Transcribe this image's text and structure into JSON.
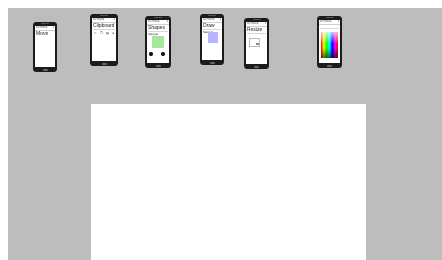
{
  "phones": [
    {
      "id": "move",
      "topbar": "ACTIVATE",
      "title": "Move"
    },
    {
      "id": "clipboard",
      "topbar": "ACTIVATE",
      "title": "Clipboard",
      "icons": [
        "cut-icon",
        "copy-icon",
        "paste-icon",
        "delete-icon"
      ]
    },
    {
      "id": "shapes",
      "topbar": "ACTIVATE",
      "title": "Shapes",
      "subtitle": "Sample",
      "shape_color": "#a8e6a0"
    },
    {
      "id": "draw",
      "topbar": "ACTIVATE",
      "title": "Draw",
      "subtitle": "Sample",
      "swatch_color": "#b8b4ff"
    },
    {
      "id": "resize",
      "topbar": "ACTIVATE",
      "title": "Resize"
    },
    {
      "id": "colors",
      "topbar": "ACTIVATE",
      "palette": "rainbow"
    }
  ],
  "colors": {
    "canvas_background": "#bdbdbd",
    "sheet_background": "#ffffff",
    "phone_frame": "#1c1c1c"
  }
}
